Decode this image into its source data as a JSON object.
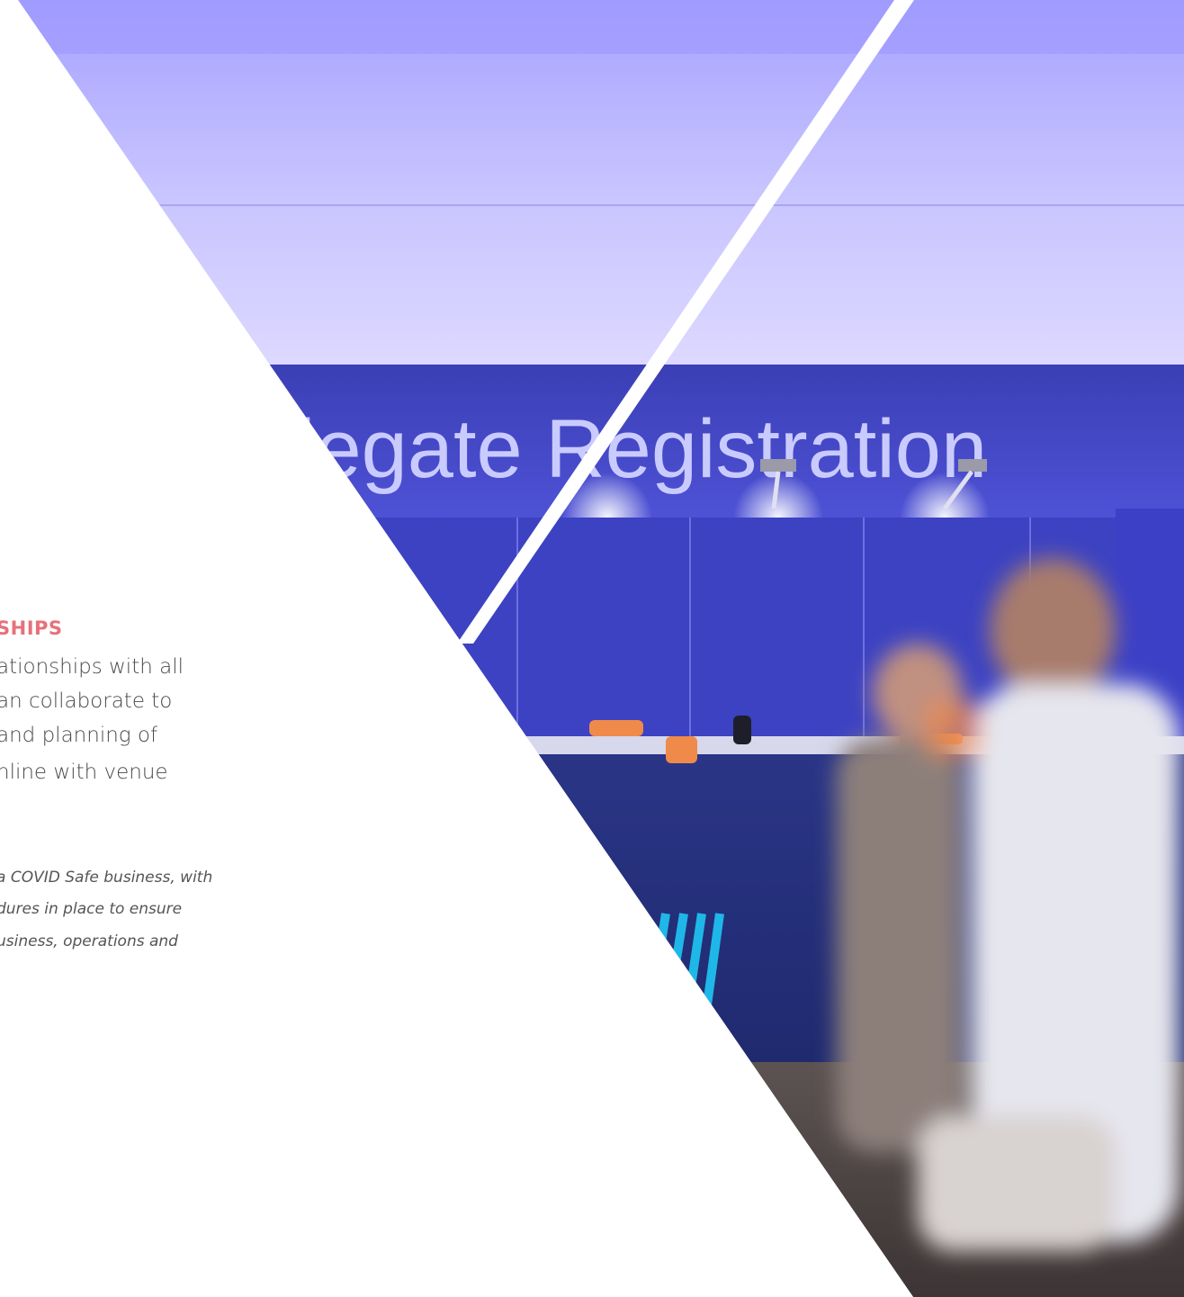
{
  "section": {
    "heading": "SHIPS",
    "body_lines": [
      "ationships with all",
      "an collaborate to",
      "and planning of",
      "nline with venue"
    ],
    "note_lines": [
      "a COVID Safe business, with",
      "dures in place to ensure",
      "usiness, operations and"
    ]
  },
  "photo": {
    "sign_text": "legate Registration"
  },
  "colors": {
    "heading_accent": "#e8707a",
    "ceiling": "#b9b5ff",
    "wall": "#3a3fb8",
    "counter": "#24307a",
    "floor": "#4a4140"
  }
}
